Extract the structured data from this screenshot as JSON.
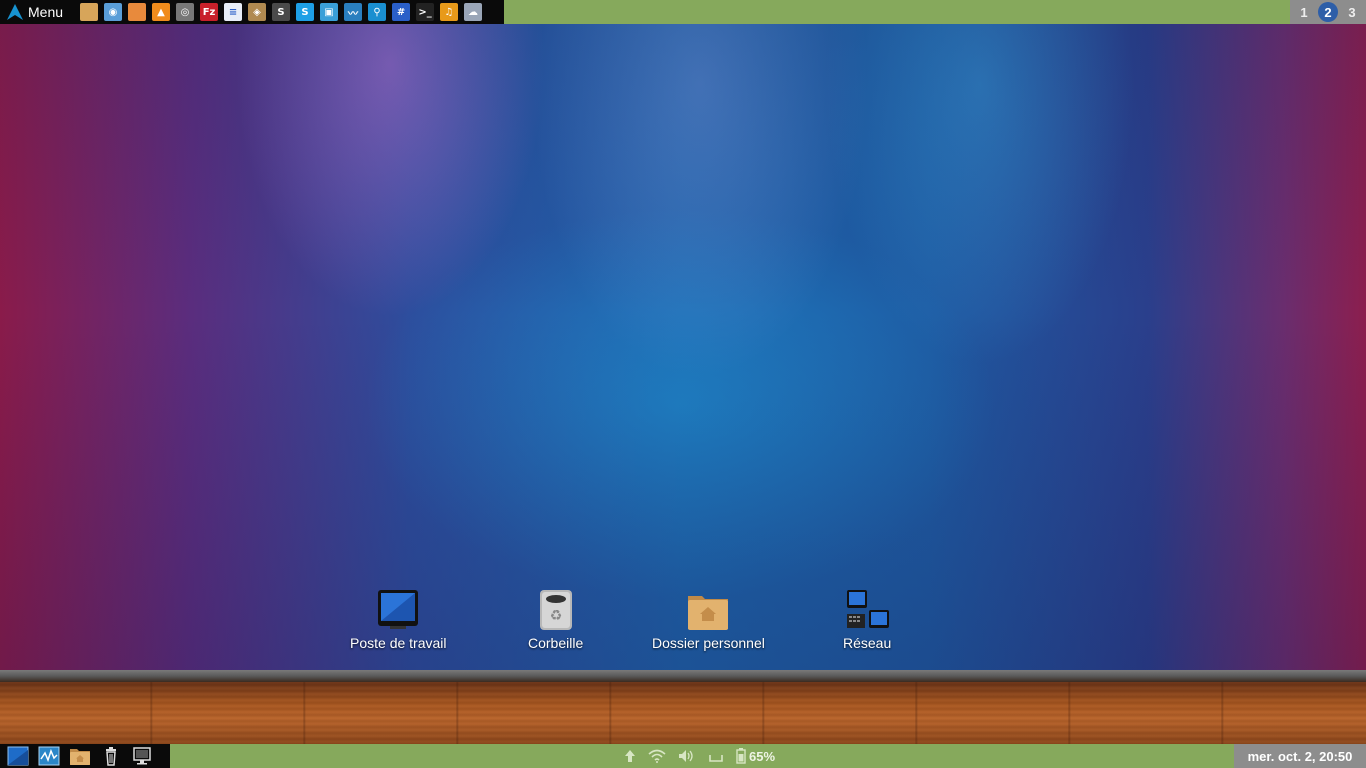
{
  "top_panel": {
    "menu_label": "Menu",
    "launchers": [
      {
        "name": "files-icon",
        "color": "#d7a55a",
        "glyph": ""
      },
      {
        "name": "chromium-icon",
        "color": "#5a9ed8",
        "glyph": "◉"
      },
      {
        "name": "image-viewer-icon",
        "color": "#e88a3c",
        "glyph": ""
      },
      {
        "name": "vlc-icon",
        "color": "#f08c1c",
        "glyph": "▲"
      },
      {
        "name": "screenshot-icon",
        "color": "#777777",
        "glyph": "◎"
      },
      {
        "name": "filezilla-icon",
        "color": "#c8202a",
        "glyph": "Fz"
      },
      {
        "name": "text-editor-icon",
        "color": "#e8eef8",
        "glyph": "≡"
      },
      {
        "name": "archive-icon",
        "color": "#b08a50",
        "glyph": "◈"
      },
      {
        "name": "sublime-text-icon",
        "color": "#4a4a4a",
        "glyph": "S"
      },
      {
        "name": "skype-icon",
        "color": "#1ea0e6",
        "glyph": "S"
      },
      {
        "name": "remote-desktop-icon",
        "color": "#3aa0d8",
        "glyph": "▣"
      },
      {
        "name": "wireshark-icon",
        "color": "#2a7fbf",
        "glyph": "〰"
      },
      {
        "name": "network-manager-icon",
        "color": "#1a8fd0",
        "glyph": "⚲"
      },
      {
        "name": "calculator-icon",
        "color": "#2a5fc8",
        "glyph": "#"
      },
      {
        "name": "terminal-icon",
        "color": "#222222",
        "glyph": ">_"
      },
      {
        "name": "music-player-icon",
        "color": "#e89a1a",
        "glyph": "♫"
      },
      {
        "name": "cloud-icon",
        "color": "#9aa6b8",
        "glyph": "☁"
      }
    ],
    "workspaces": [
      "1",
      "2",
      "3"
    ],
    "active_workspace": "2"
  },
  "desktop": {
    "icons": [
      {
        "label": "Poste de travail"
      },
      {
        "label": "Corbeille"
      },
      {
        "label": "Dossier personnel"
      },
      {
        "label": "Réseau"
      }
    ]
  },
  "bottom_panel": {
    "battery_percent": "65%",
    "clock": "mer. oct.  2, 20:50"
  },
  "colors": {
    "panel_green": "#86a95c",
    "panel_black": "#0a0a0a",
    "workspace_active": "#2d5ea8"
  }
}
